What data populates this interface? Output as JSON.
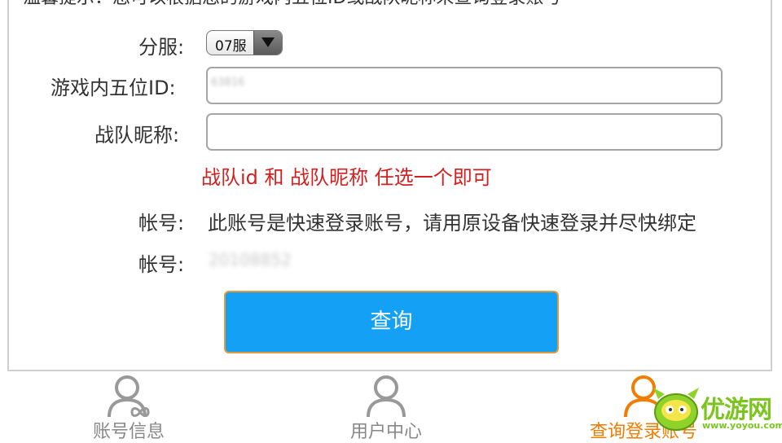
{
  "tip": "温馨提示：您可以根据您的游戏内五位ID或战队昵称来查询登录账号",
  "form": {
    "server_label": "分服:",
    "server_value": "07服",
    "game_id_label": "游戏内五位ID:",
    "game_id_value": "63816",
    "team_label": "战队昵称:",
    "team_value": "",
    "hint": "战队id 和 战队昵称 任选一个即可",
    "account_label_1": "帐号:",
    "account_value_1": "此账号是快速登录账号，请用原设备快速登录并尽快绑定",
    "account_label_2": "帐号:",
    "account_value_2": "20108852",
    "query_button": "查询"
  },
  "tabs": [
    {
      "label": "账号信息",
      "icon": "user-infinity-icon",
      "active": false
    },
    {
      "label": "用户中心",
      "icon": "user-icon",
      "active": false
    },
    {
      "label": "查询登录账号",
      "icon": "user-icon",
      "active": true
    }
  ],
  "watermark": {
    "brand": "优游网",
    "site": "www.yoyou.com"
  },
  "colors": {
    "accent": "#14a0f5",
    "active_tab": "#f07d00",
    "hint": "#d41f1f",
    "watermark": "#7cc520"
  }
}
